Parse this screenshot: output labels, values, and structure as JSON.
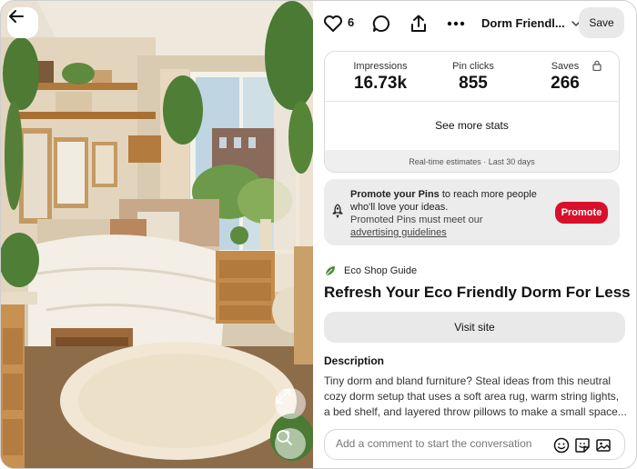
{
  "toolbar": {
    "like_count": "6",
    "board_name": "Dorm Friendl...",
    "save_label": "Save",
    "icons": [
      "heart-icon",
      "comment-icon",
      "share-icon",
      "more-icon",
      "chevron-down-icon"
    ]
  },
  "image": {
    "alt": "Cozy dorm room with bed, shelves, plants and area rug",
    "controls": [
      "back-arrow-icon",
      "expand-icon",
      "visual-search-icon"
    ]
  },
  "stats": {
    "items": [
      {
        "label": "Impressions",
        "value": "16.73k"
      },
      {
        "label": "Pin clicks",
        "value": "855"
      },
      {
        "label": "Saves",
        "value": "266"
      }
    ],
    "see_more": "See more stats",
    "footer": "Real-time estimates · Last 30 days"
  },
  "promo": {
    "headline": "Promote your Pins",
    "text": " to reach more people who'll love your ideas.",
    "note": "Promoted Pins must meet our ",
    "link": "advertising guidelines",
    "button": "Promote"
  },
  "source": {
    "name": "Eco Shop Guide"
  },
  "pin": {
    "title": "Refresh Your Eco Friendly Dorm For Less",
    "visit_label": "Visit site",
    "description_heading": "Description",
    "description": "Tiny dorm and bland furniture? Steal ideas from this neutral cozy dorm setup that uses a soft area rug, warm string lights, a bed shelf, and layered throw pillows to make a small space..."
  },
  "comment": {
    "placeholder": "Add a comment to start the conversation"
  },
  "colors": {
    "accent": "#d8102b",
    "button_gray": "#e9e9e9"
  }
}
